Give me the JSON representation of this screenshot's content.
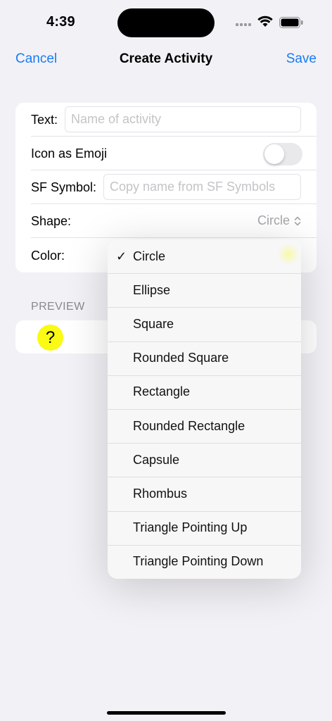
{
  "status": {
    "time": "4:39"
  },
  "nav": {
    "cancel": "Cancel",
    "title": "Create Activity",
    "save": "Save"
  },
  "form": {
    "text_label": "Text:",
    "text_placeholder": "Name of activity",
    "emoji_label": "Icon as Emoji",
    "emoji_on": false,
    "sf_label": "SF Symbol:",
    "sf_placeholder": "Copy name from SF Symbols",
    "shape_label": "Shape:",
    "shape_value": "Circle",
    "color_label": "Color:"
  },
  "preview": {
    "header": "PREVIEW",
    "icon_text": "?",
    "color": "#fafa14"
  },
  "menu": {
    "check": "✓",
    "items": [
      "Circle",
      "Ellipse",
      "Square",
      "Rounded Square",
      "Rectangle",
      "Rounded Rectangle",
      "Capsule",
      "Rhombus",
      "Triangle Pointing Up",
      "Triangle Pointing Down"
    ],
    "selected_index": 0
  },
  "colors": {
    "accent": "#1a7cf2",
    "background": "#f2f1f6"
  }
}
